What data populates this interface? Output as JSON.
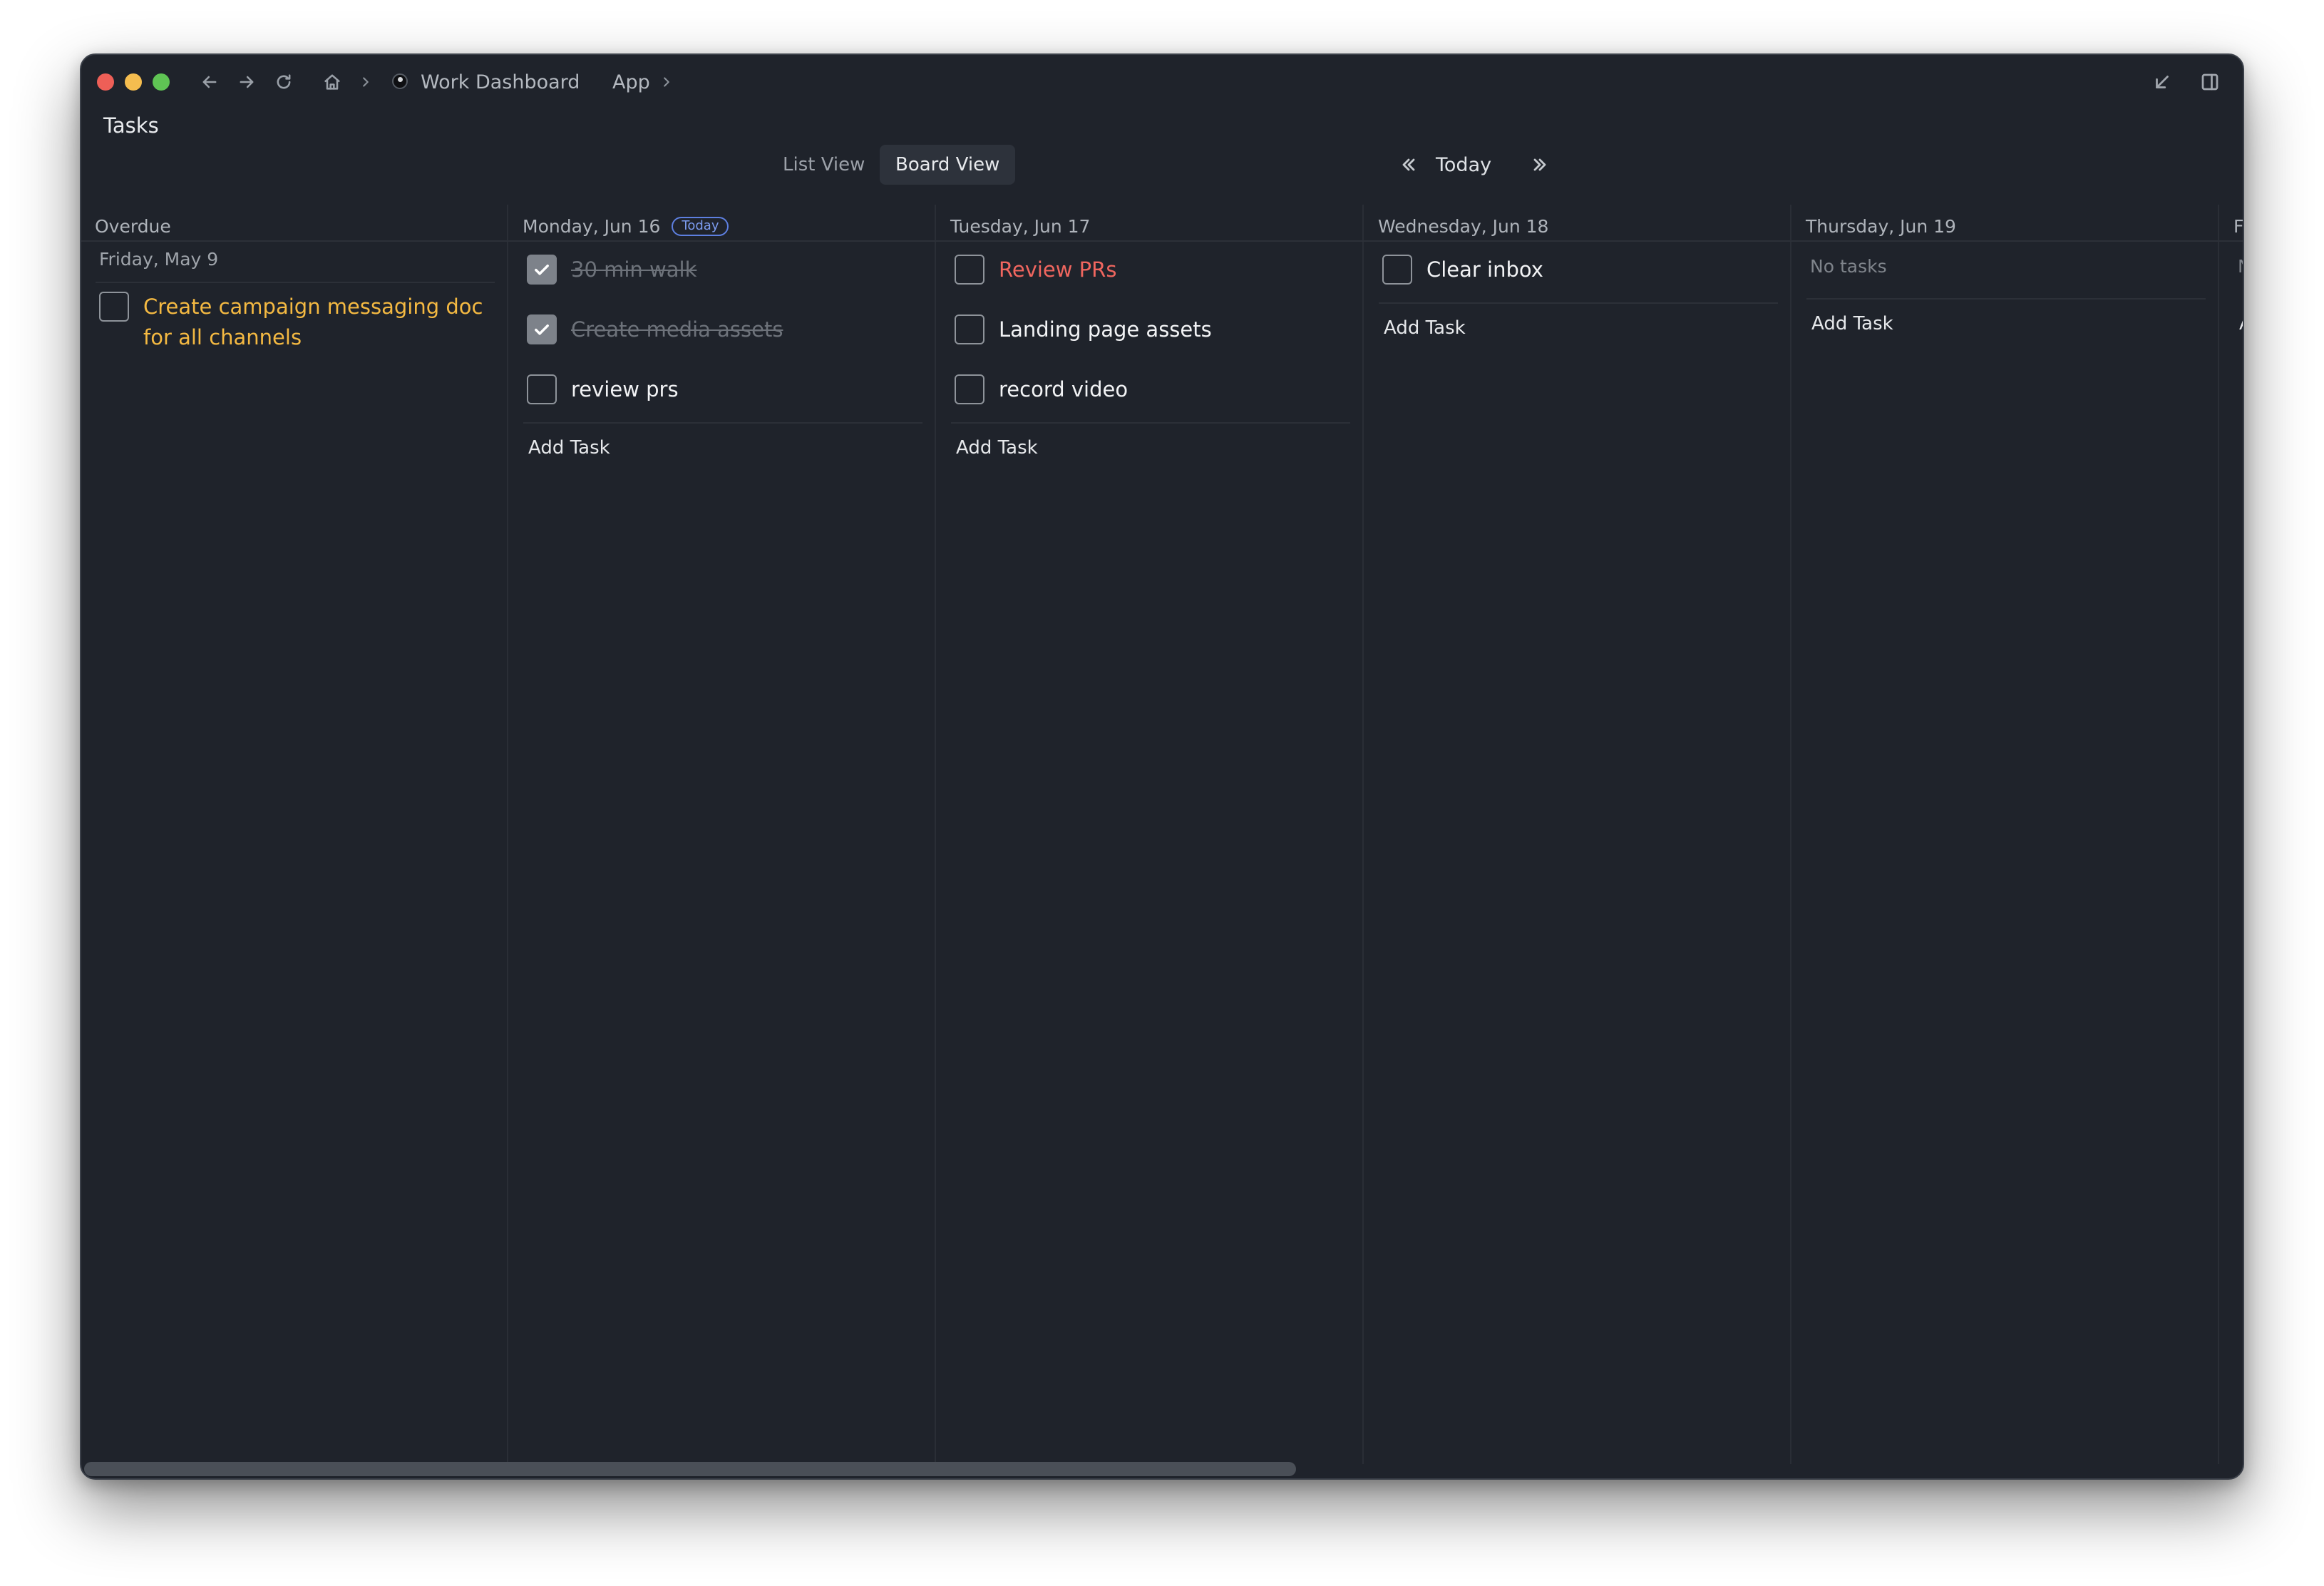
{
  "breadcrumb": {
    "workspace": "Work Dashboard",
    "page": "App"
  },
  "page_title": "Tasks",
  "views": {
    "list": "List View",
    "board": "Board View"
  },
  "date_nav": {
    "today": "Today"
  },
  "columns": {
    "overdue": {
      "title": "Overdue",
      "group_label": "Friday, May 9",
      "tasks": [
        {
          "text": "Create campaign messaging doc for all channels",
          "done": false
        }
      ]
    },
    "mon": {
      "title": "Monday, Jun 16",
      "badge": "Today",
      "tasks": [
        {
          "text": "30 min walk",
          "done": true
        },
        {
          "text": "Create media assets",
          "done": true
        },
        {
          "text": "review prs",
          "done": false
        }
      ],
      "add_task": "Add Task"
    },
    "tue": {
      "title": "Tuesday, Jun 17",
      "tasks": [
        {
          "text": "Review PRs",
          "done": false
        },
        {
          "text": "Landing page assets",
          "done": false
        },
        {
          "text": "record video",
          "done": false
        }
      ],
      "add_task": "Add Task"
    },
    "wed": {
      "title": "Wednesday, Jun 18",
      "tasks": [
        {
          "text": "Clear inbox",
          "done": false
        }
      ],
      "add_task": "Add Task"
    },
    "thu": {
      "title": "Thursday, Jun 19",
      "empty": "No tasks",
      "add_task": "Add Task"
    },
    "fri_clipped": {
      "title": "F",
      "empty": "N",
      "add_task": "A"
    }
  },
  "colors": {
    "background": "#1f232b",
    "overdue_text": "#f4b942",
    "priority_red": "#f0665f",
    "today_badge": "#5d7fe0"
  }
}
